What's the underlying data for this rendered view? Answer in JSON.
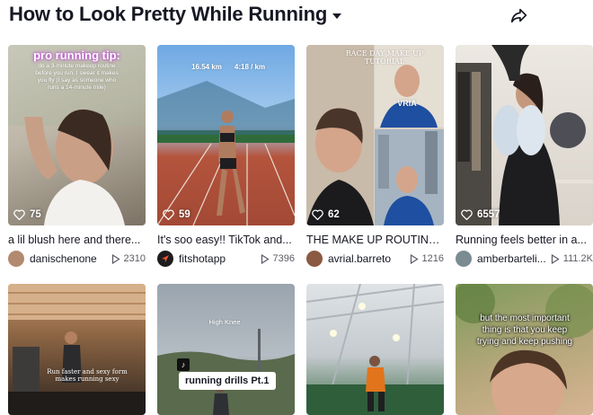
{
  "header": {
    "title": "How to Look Pretty While Running",
    "share_icon": "share-icon",
    "caret_icon": "chevron-down-icon"
  },
  "videos": [
    {
      "caption": "a lil blush here and there...",
      "author": "danischenone",
      "likes": "75",
      "views": "2310",
      "overlay": {
        "headline": "pro running tip:",
        "body": "do a 3-minute makeup routine before you run. I swear it makes you fly (I say as someone who runs a 14-minute mile)"
      },
      "colors": {
        "bg1": "#c9c4b8",
        "bg2": "#8d8578",
        "avatar": "#b38a6f"
      }
    },
    {
      "caption": "It's soo easy!! TikTok and...",
      "author": "fitshotapp",
      "likes": "59",
      "views": "7396",
      "overlay": {
        "distance": "16.54 km",
        "pace": "4:18 / km"
      },
      "colors": {
        "bg1": "#7fb3e6",
        "bg2": "#b7573f",
        "avatar": "#f2542d"
      }
    },
    {
      "caption": "THE MAKE UP ROUTINE...",
      "author": "avrial.barreto",
      "likes": "62",
      "views": "1216",
      "overlay": {
        "headline": "RACE DAY MAKE UP TUTORIAL",
        "bib": "VRIA"
      },
      "colors": {
        "bg1": "#d7d0c5",
        "bg2": "#5d4a3c",
        "avatar": "#8a5a42"
      }
    },
    {
      "caption": "Running feels better in a...",
      "author": "amberbarteli...",
      "likes": "6557",
      "views": "111.2K",
      "colors": {
        "bg1": "#e7e2db",
        "bg2": "#2b2b2e",
        "avatar": "#7a8c92"
      }
    },
    {
      "overlay": {
        "text": "Run faster and sexy form makes running sexy"
      },
      "colors": {
        "bg1": "#b98b5d",
        "bg2": "#3a2a20"
      }
    },
    {
      "overlay": {
        "label": "High Knee",
        "tag": "running drills Pt.1"
      },
      "colors": {
        "bg1": "#9fa9b4",
        "bg2": "#4f5a45"
      }
    },
    {
      "colors": {
        "bg1": "#d9dee2",
        "bg2": "#2e5a3a"
      }
    },
    {
      "overlay": {
        "text": "but the most important thing is that you keep trying and keep pushing"
      },
      "colors": {
        "bg1": "#7d9a5a",
        "bg2": "#d3b08e"
      }
    }
  ]
}
